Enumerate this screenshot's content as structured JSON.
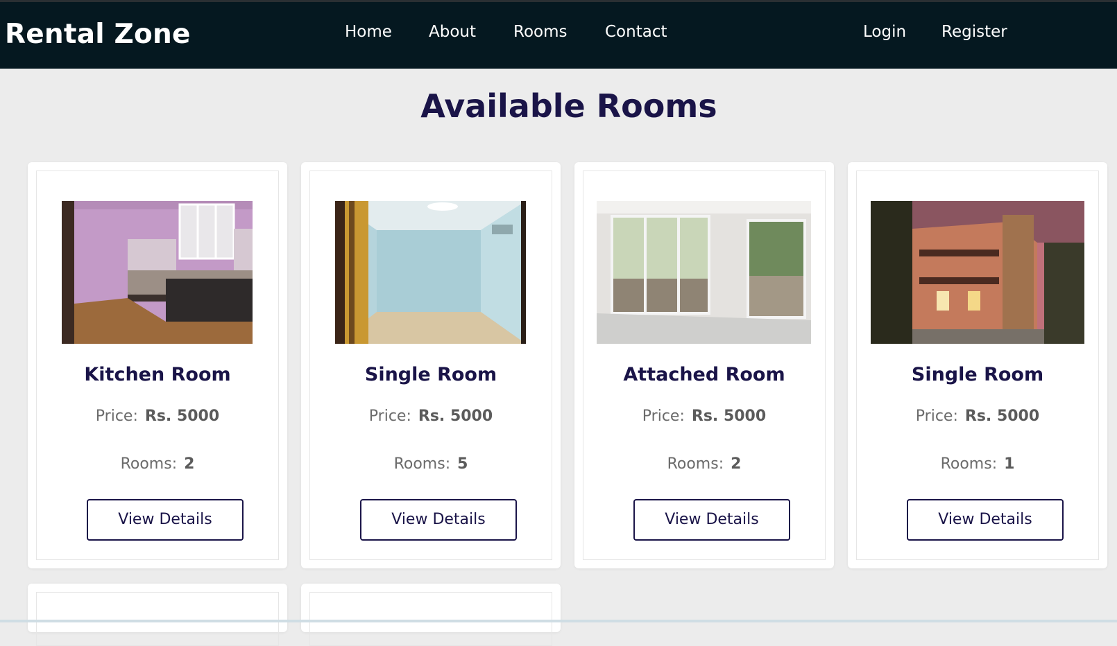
{
  "navbar": {
    "brand": "Rental Zone",
    "links": [
      "Home",
      "About",
      "Rooms",
      "Contact"
    ],
    "auth": [
      "Login",
      "Register"
    ]
  },
  "page": {
    "title": "Available Rooms"
  },
  "rooms": [
    {
      "name": "Kitchen Room",
      "price_label": "Price:",
      "price": "Rs. 5000",
      "rooms_label": "Rooms:",
      "rooms": "2",
      "button": "View Details",
      "image": "kitchen-room-photo"
    },
    {
      "name": "Single Room",
      "price_label": "Price:",
      "price": "Rs. 5000",
      "rooms_label": "Rooms:",
      "rooms": "5",
      "button": "View Details",
      "image": "blue-room-photo"
    },
    {
      "name": "Attached Room",
      "price_label": "Price:",
      "price": "Rs. 5000",
      "rooms_label": "Rooms:",
      "rooms": "2",
      "button": "View Details",
      "image": "glass-window-room-photo"
    },
    {
      "name": "Single Room",
      "price_label": "Price:",
      "price": "Rs. 5000",
      "rooms_label": "Rooms:",
      "rooms": "1",
      "button": "View Details",
      "image": "house-exterior-photo"
    }
  ],
  "colors": {
    "nav_bg": "#051820",
    "title": "#1a1448",
    "page_bg": "#ececec"
  }
}
